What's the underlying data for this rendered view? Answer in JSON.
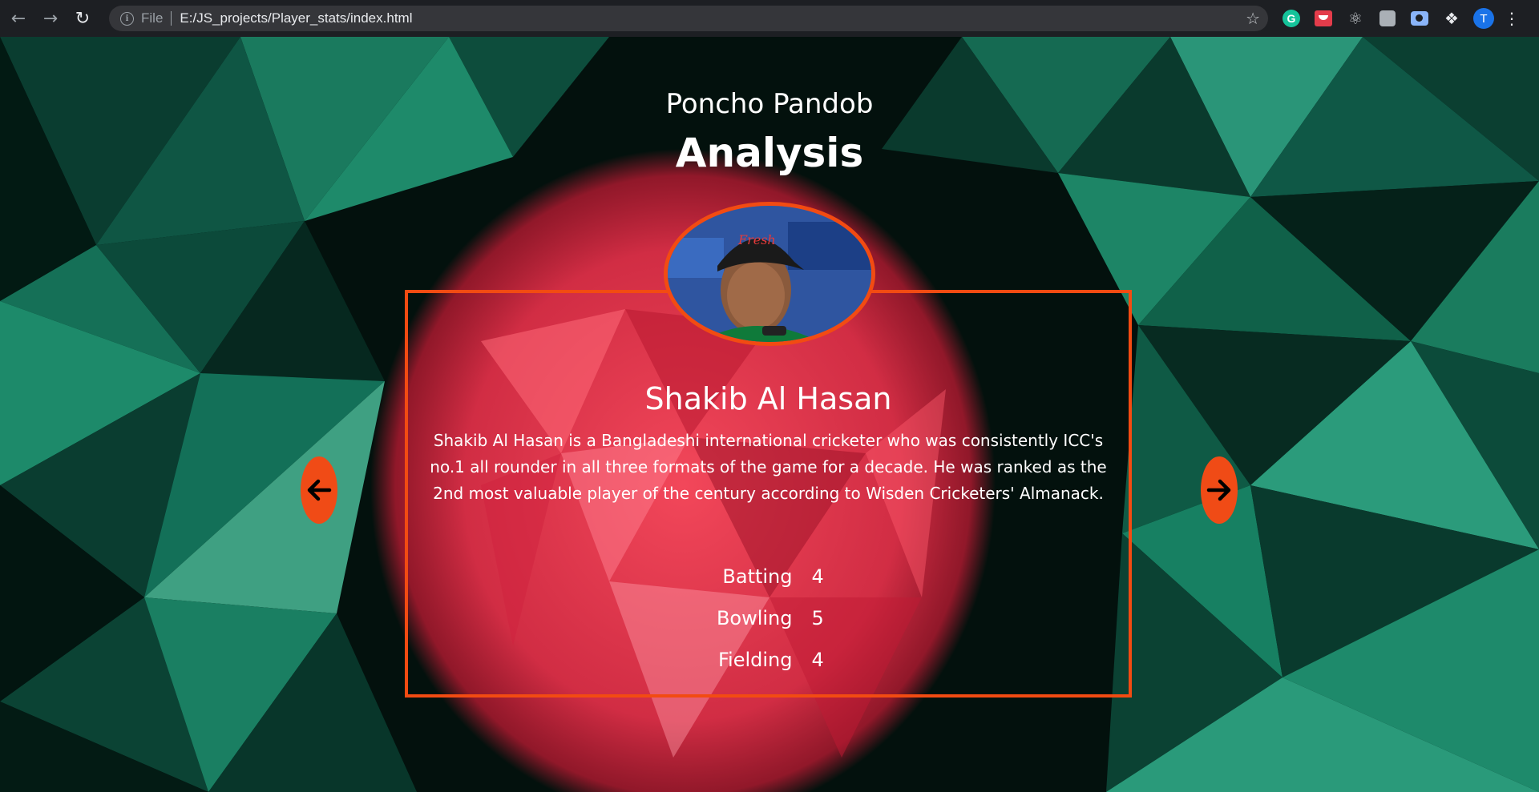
{
  "browser": {
    "scheme": "File",
    "url": "E:/JS_projects/Player_stats/index.html",
    "profile_initial": "T",
    "nav_icons": [
      "back-arrow-icon",
      "forward-arrow-icon",
      "reload-icon"
    ],
    "extensions": [
      "grammarly-icon",
      "pocket-icon",
      "react-devtools-icon",
      "extension-icon",
      "screen-capture-icon",
      "extensions-puzzle-icon"
    ]
  },
  "header": {
    "site_name": "Poncho Pandob",
    "title": "Analysis"
  },
  "player": {
    "name": "Shakib Al Hasan",
    "bio": "Shakib Al Hasan is a Bangladeshi international cricketer who was consistently ICC's no.1 all rounder in all three formats of the game for a decade. He was ranked as the 2nd most valuable player of the century according to Wisden Cricketers' Almanack.",
    "photo_cap_text": "Fresh",
    "stats": [
      {
        "label": "Batting",
        "value": "4"
      },
      {
        "label": "Bowling",
        "value": "5"
      },
      {
        "label": "Fielding",
        "value": "4"
      }
    ]
  },
  "controls": {
    "prev_icon": "arrow-left-icon",
    "next_icon": "arrow-right-icon"
  },
  "colors": {
    "accent": "#f24b12",
    "flag_green": "#0b5a43",
    "flag_red": "#f03a4f"
  }
}
